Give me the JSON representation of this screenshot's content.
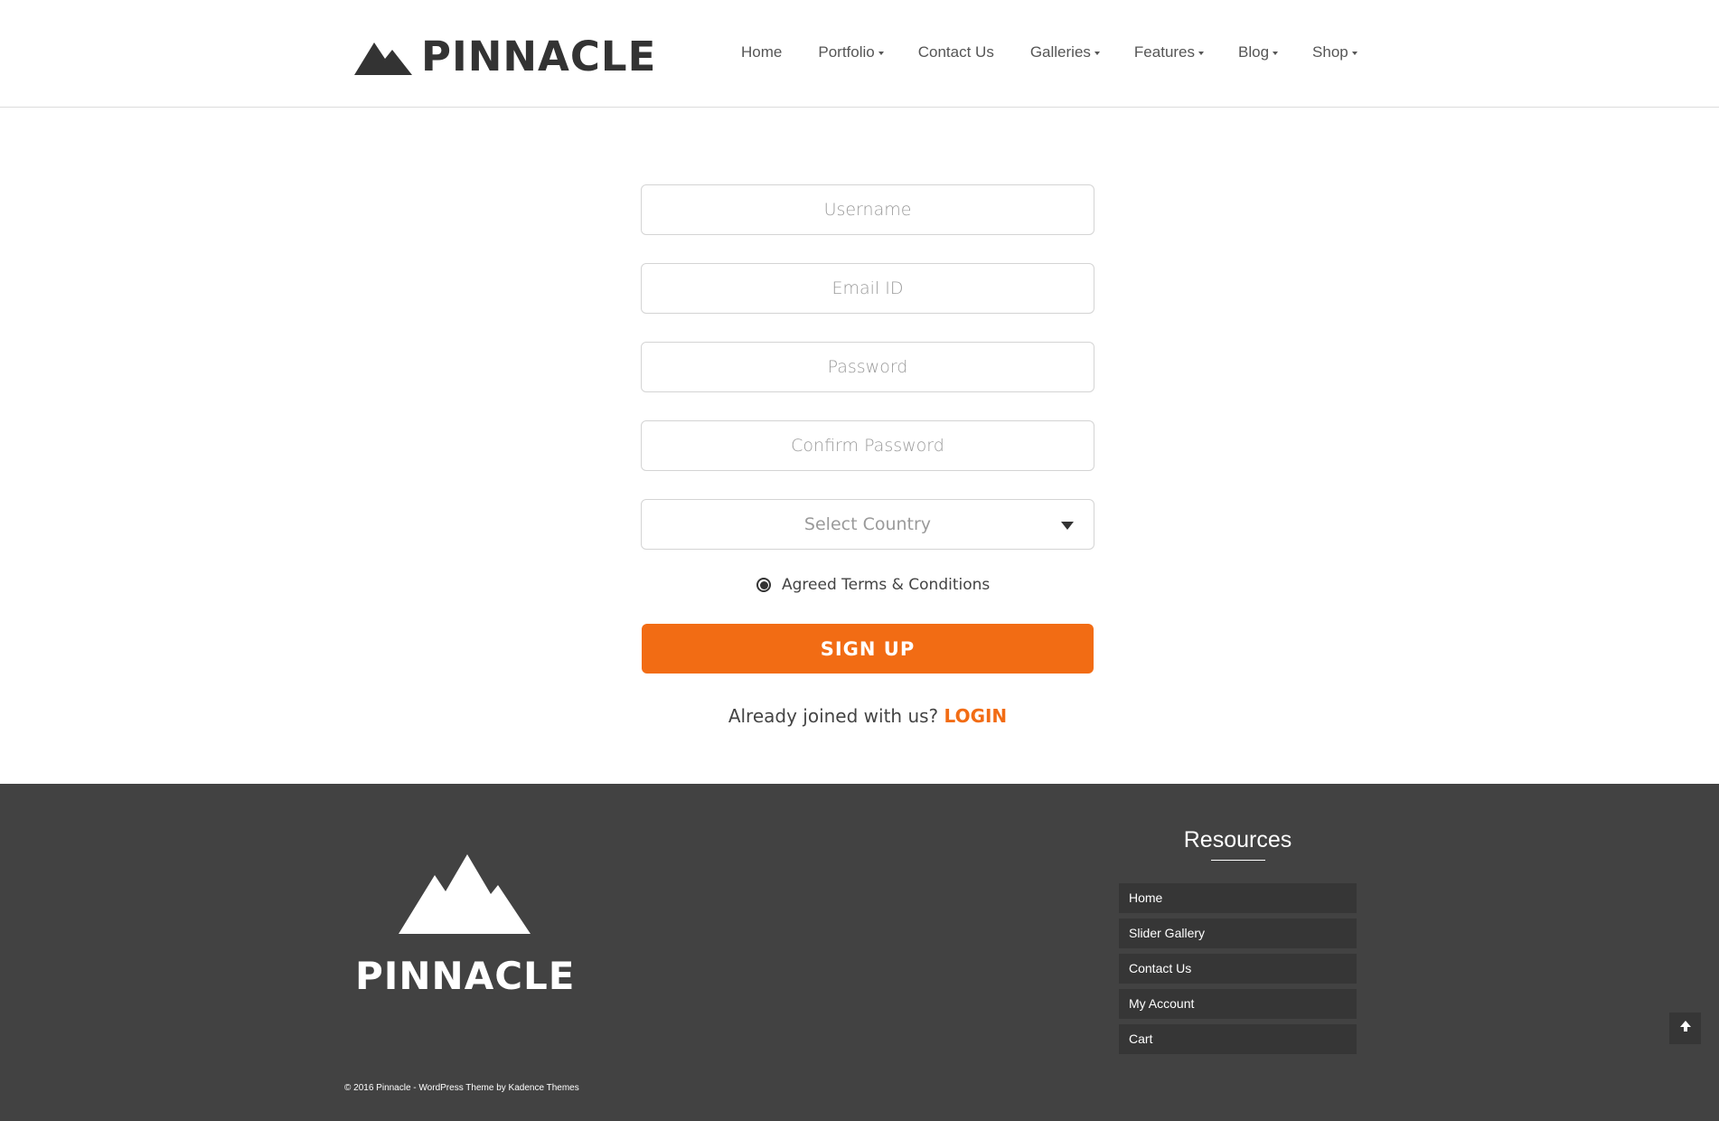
{
  "header": {
    "logo_text": "PINNACLE",
    "nav": [
      {
        "label": "Home",
        "dropdown": false
      },
      {
        "label": "Portfolio",
        "dropdown": true
      },
      {
        "label": "Contact Us",
        "dropdown": false
      },
      {
        "label": "Galleries",
        "dropdown": true
      },
      {
        "label": "Features",
        "dropdown": true
      },
      {
        "label": "Blog",
        "dropdown": true
      },
      {
        "label": "Shop",
        "dropdown": true
      }
    ]
  },
  "form": {
    "username_placeholder": "Username",
    "email_placeholder": "Email ID",
    "password_placeholder": "Password",
    "confirm_password_placeholder": "Confirm Password",
    "country_select_label": "Select Country",
    "terms_label": "Agreed Terms & Conditions",
    "terms_checked": true,
    "signup_label": "SIGN UP",
    "already_joined_text": "Already joined with us?",
    "login_label": "LOGIN"
  },
  "footer": {
    "logo_text": "PINNACLE",
    "resources_title": "Resources",
    "resources": [
      "Home",
      "Slider Gallery",
      "Contact Us",
      "My Account",
      "Cart"
    ],
    "copyright": "© 2016 Pinnacle - WordPress Theme by Kadence Themes"
  },
  "icons": {
    "header_logo": "mountain-icon",
    "footer_logo": "mountain-icon",
    "select_arrow": "caret-down-icon",
    "back_to_top": "arrow-up-icon"
  },
  "colors": {
    "accent": "#f26c14",
    "footer_bg": "#424242",
    "footer_item_bg": "#363636",
    "text_dark": "#333333"
  }
}
